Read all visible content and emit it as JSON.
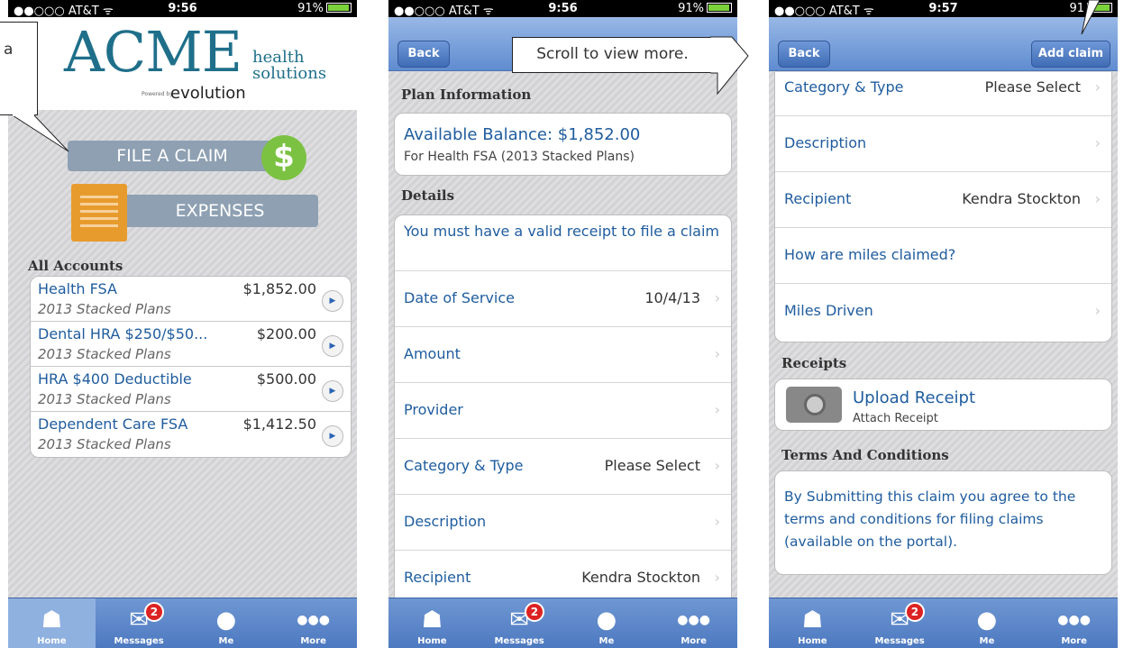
{
  "screens": [
    {
      "status": {
        "carrier": "●●○○○ AT&T ᯤ",
        "time": "9:56",
        "battery": "91%"
      },
      "logo": {
        "acme": "ACME",
        "health": "health",
        "solutions": "solutions",
        "powered": "Powered by",
        "evolution": "evolution"
      },
      "file_claim": "FILE A CLAIM",
      "expenses": "EXPENSES",
      "section_title": "All Accounts",
      "accounts": [
        {
          "name": "Health FSA",
          "plan": "2013 Stacked Plans",
          "amount": "$1,852.00"
        },
        {
          "name": "Dental HRA $250/$50...",
          "plan": "2013 Stacked Plans",
          "amount": "$200.00"
        },
        {
          "name": "HRA $400 Deductible",
          "plan": "2013 Stacked Plans",
          "amount": "$500.00"
        },
        {
          "name": "Dependent Care FSA",
          "plan": "2013 Stacked Plans",
          "amount": "$1,412.50"
        }
      ],
      "callout": "a",
      "tabs": [
        {
          "label": "Home",
          "icon": "home-icon"
        },
        {
          "label": "Messages",
          "icon": "envelope-icon",
          "badge": "2"
        },
        {
          "label": "Me",
          "icon": "person-icon"
        },
        {
          "label": "More",
          "icon": "more-icon"
        }
      ]
    },
    {
      "status": {
        "carrier": "●●○○○ AT&T ᯤ",
        "time": "9:56",
        "battery": "91%"
      },
      "back": "Back",
      "callout": "Scroll to view more.",
      "plan_section": "Plan Information",
      "balance": "Available Balance: $1,852.00",
      "balance_sub": "For Health FSA (2013 Stacked Plans)",
      "details_section": "Details",
      "rows": [
        {
          "label": "You must have a valid receipt to file a claim",
          "value": ""
        },
        {
          "label": "Date of Service",
          "value": "10/4/13"
        },
        {
          "label": "Amount",
          "value": ""
        },
        {
          "label": "Provider",
          "value": ""
        },
        {
          "label": "Category & Type",
          "value": "Please Select"
        },
        {
          "label": "Description",
          "value": ""
        },
        {
          "label": "Recipient",
          "value": "Kendra Stockton"
        }
      ],
      "tabs": [
        {
          "label": "Home"
        },
        {
          "label": "Messages",
          "badge": "2"
        },
        {
          "label": "Me"
        },
        {
          "label": "More"
        }
      ]
    },
    {
      "status": {
        "carrier": "●●○○○ AT&T ᯤ",
        "time": "9:57",
        "battery": "91"
      },
      "back": "Back",
      "add_claim": "Add claim",
      "rows": [
        {
          "label": "Category & Type",
          "value": "Please Select"
        },
        {
          "label": "Description",
          "value": ""
        },
        {
          "label": "Recipient",
          "value": "Kendra Stockton"
        },
        {
          "label": "How are miles claimed?",
          "value": ""
        },
        {
          "label": "Miles Driven",
          "value": ""
        }
      ],
      "receipts_section": "Receipts",
      "upload_title": "Upload Receipt",
      "upload_sub": "Attach Receipt",
      "terms_section": "Terms And Conditions",
      "terms_text": "By Submitting this claim you agree to the terms and conditions for filing claims (available on the portal).",
      "tabs": [
        {
          "label": "Home"
        },
        {
          "label": "Messages",
          "badge": "2"
        },
        {
          "label": "Me"
        },
        {
          "label": "More"
        }
      ]
    }
  ]
}
